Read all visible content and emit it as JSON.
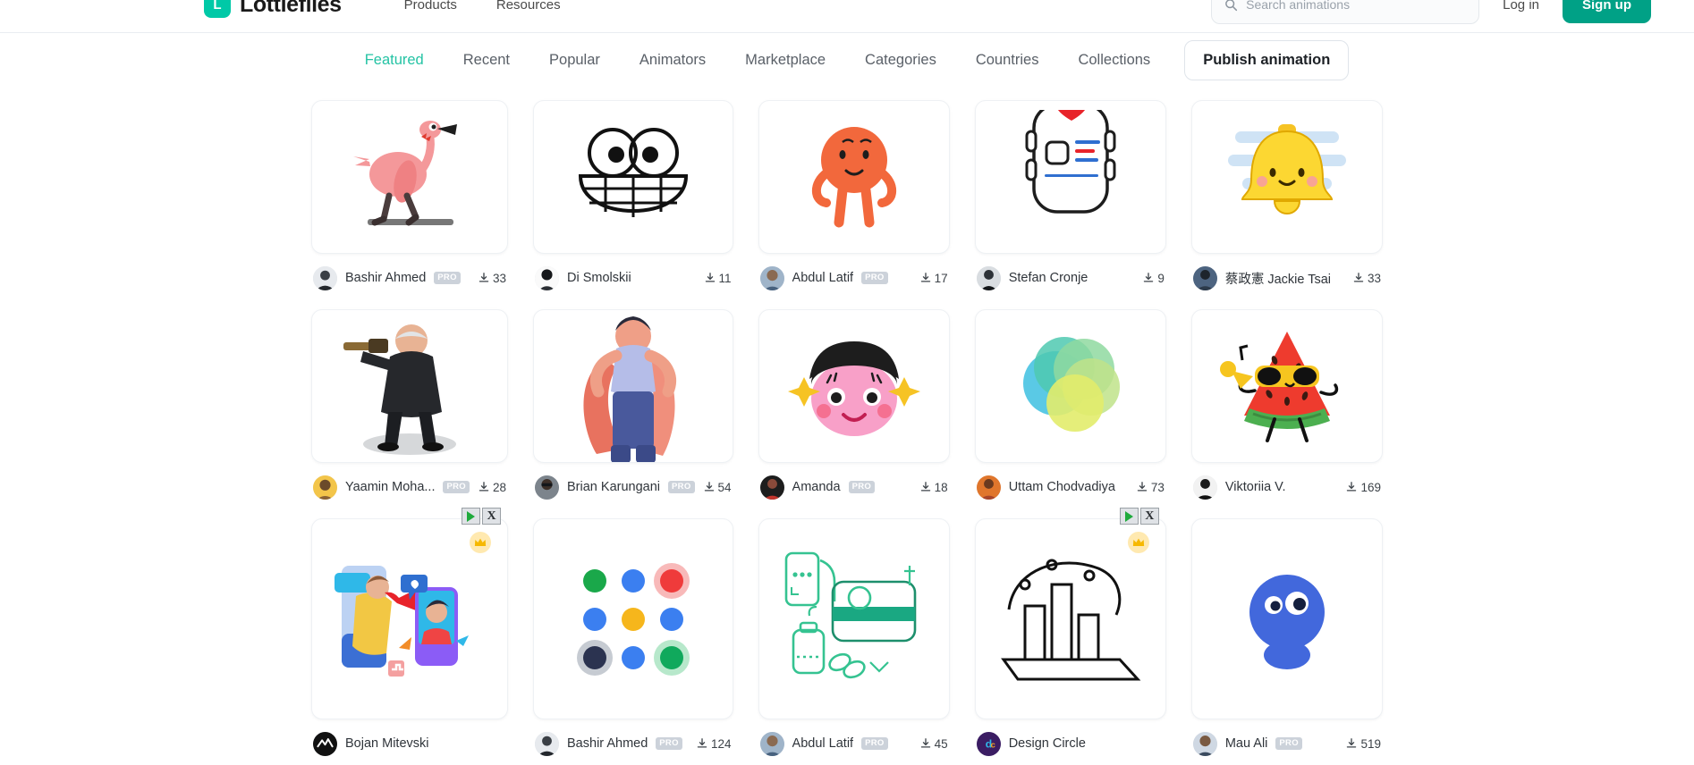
{
  "header": {
    "brand_mark": "L",
    "brand_name": "Lottiefiles",
    "nav": [
      {
        "label": "Products",
        "name": "header-nav-products"
      },
      {
        "label": "Resources",
        "name": "header-nav-resources"
      }
    ],
    "search": {
      "placeholder": "Search animations",
      "icon": "search-icon"
    },
    "login_label": "Log in",
    "signup_label": "Sign up",
    "accent_color": "#00a186"
  },
  "subnav": {
    "items": [
      {
        "label": "Featured",
        "active": true
      },
      {
        "label": "Recent",
        "active": false
      },
      {
        "label": "Popular",
        "active": false
      },
      {
        "label": "Animators",
        "active": false
      },
      {
        "label": "Marketplace",
        "active": false
      },
      {
        "label": "Categories",
        "active": false
      },
      {
        "label": "Countries",
        "active": false
      },
      {
        "label": "Collections",
        "active": false
      }
    ],
    "cta_label": "Publish animation",
    "active_color": "#24c3a4"
  },
  "grid": {
    "rows": [
      {
        "cards": [
          {
            "art": "flamingo",
            "author": "Bashir Ahmed",
            "pro": true,
            "downloads": "33"
          },
          {
            "art": "smile",
            "author": "Di Smolskii",
            "pro": false,
            "downloads": "11"
          },
          {
            "art": "orange",
            "author": "Abdul Latif",
            "pro": true,
            "downloads": "17"
          },
          {
            "art": "watch",
            "author": "Stefan Cronje",
            "pro": false,
            "downloads": "9"
          },
          {
            "art": "bell",
            "author": "蔡政憲 Jackie Tsai",
            "pro": false,
            "downloads": "33"
          }
        ]
      },
      {
        "cards": [
          {
            "art": "gunman",
            "author": "Yaamin Moha...",
            "pro": true,
            "downloads": "28"
          },
          {
            "art": "superhero",
            "author": "Brian Karungani",
            "pro": true,
            "downloads": "54"
          },
          {
            "art": "face",
            "author": "Amanda",
            "pro": true,
            "downloads": "18"
          },
          {
            "art": "circles",
            "author": "Uttam Chodvadiya",
            "pro": false,
            "downloads": "73"
          },
          {
            "art": "watermelon",
            "author": "Viktoriia V.",
            "pro": false,
            "downloads": "169"
          }
        ]
      },
      {
        "cards": [
          {
            "art": "megaphone",
            "author": "Bojan Mitevski",
            "pro": false,
            "downloads": "",
            "plugin_badges": true,
            "crown": true
          },
          {
            "art": "dots",
            "author": "Bashir Ahmed",
            "pro": true,
            "downloads": "124"
          },
          {
            "art": "medical",
            "author": "Abdul Latif",
            "pro": true,
            "downloads": "45"
          },
          {
            "art": "barchart",
            "author": "Design Circle",
            "pro": false,
            "downloads": "",
            "plugin_badges": true,
            "crown": true
          },
          {
            "art": "blueblob",
            "author": "Mau Ali",
            "pro": true,
            "downloads": "519"
          }
        ]
      }
    ],
    "pro_label": "PRO",
    "download_icon": "download-icon",
    "play_badge_icon": "play-placeholder-icon",
    "close_badge_icon": "close-placeholder-icon",
    "close_badge_label": "X",
    "crown_icon": "crown-icon"
  }
}
